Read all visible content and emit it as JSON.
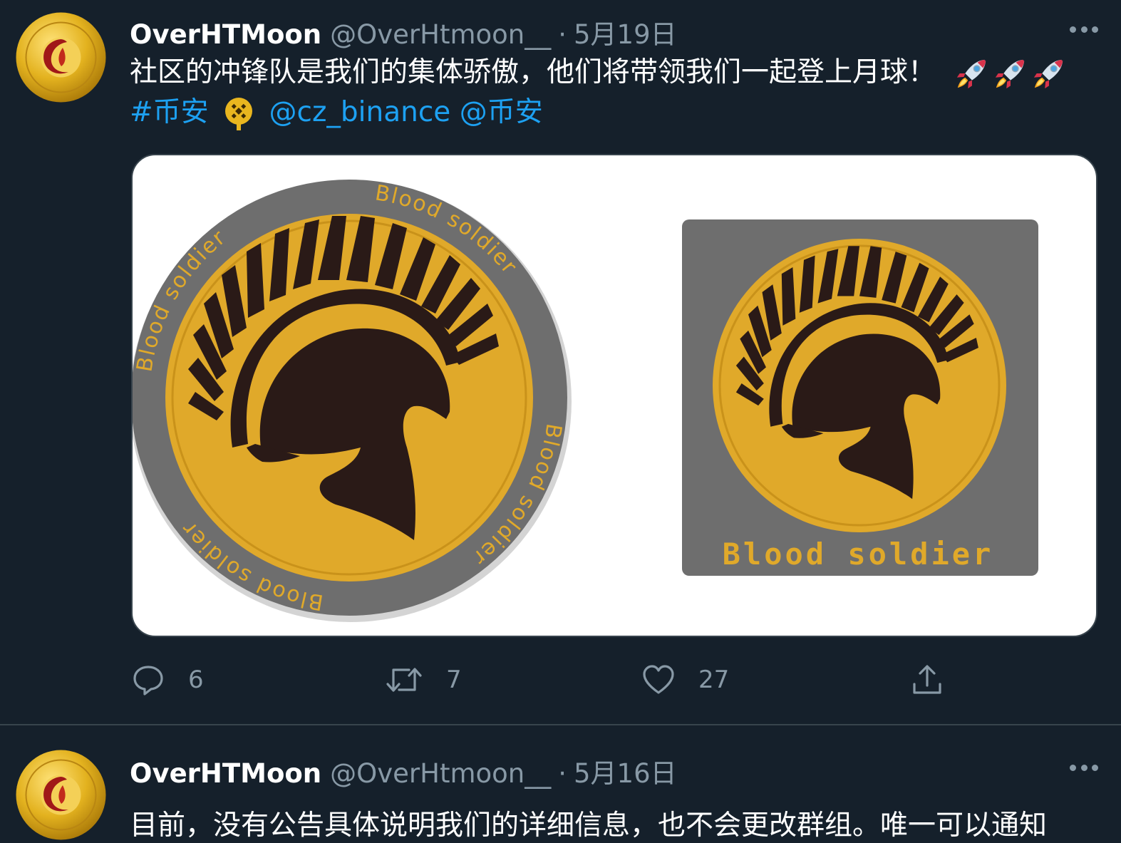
{
  "tweets": [
    {
      "author_name": "OverHTMoon",
      "handle": "@OverHtmoon__",
      "separator": "·",
      "date": "5月19日",
      "text_line1": "社区的冲锋队是我们的集体骄傲，他们将带领我们一起登上月球！",
      "hashtag": "#币安",
      "mention1": "@cz_binance",
      "mention2": "@币安",
      "media_left_ring_text": "Blood soldier",
      "media_right_caption": "Blood soldier",
      "reply_count": "6",
      "retweet_count": "7",
      "like_count": "27"
    },
    {
      "author_name": "OverHTMoon",
      "handle": "@OverHtmoon__",
      "separator": "·",
      "date": "5月16日",
      "text_line1": "目前，没有公告具体说明我们的详细信息，也不会更改群组。唯一可以通知"
    }
  ],
  "icons": {
    "more": "more-horizontal-icon",
    "reply": "reply-icon",
    "retweet": "retweet-icon",
    "like": "heart-icon",
    "share": "share-icon",
    "rocket": "rocket-emoji",
    "binance": "binance-emoji"
  },
  "colors": {
    "background": "#15202b",
    "link": "#1da1f2",
    "secondary_text": "#8899a6",
    "divider": "#38444d",
    "gold": "#e0a92a",
    "dark_brown": "#2a1a17",
    "gray_ring": "#6e6e6e"
  }
}
